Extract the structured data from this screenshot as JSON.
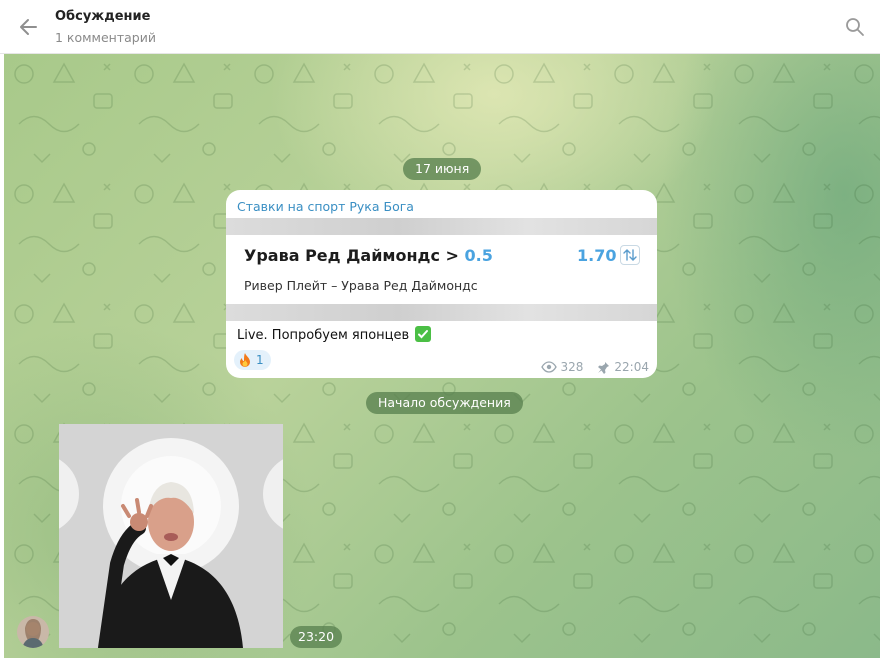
{
  "header": {
    "title": "Обсуждение",
    "subtitle": "1 комментарий",
    "back_icon": "arrow-left-icon",
    "search_icon": "search-icon"
  },
  "chat": {
    "date_separator": "17 июня",
    "discussion_start": "Начало обсуждения"
  },
  "post": {
    "channel": "Ставки на спорт Рука Бога",
    "bet_title": "Урава Ред Даймондс > ",
    "bet_value": "0.5",
    "odds": "1.70",
    "match": "Ривер Плейт – Урава Ред Даймондс",
    "text": "Live. Попробуем японцев",
    "reaction_emoji": "🔥",
    "reaction_count": "1",
    "views": "328",
    "time": "22:04"
  },
  "video_message": {
    "time": "23:20"
  },
  "colors": {
    "accent": "#4aa3e0",
    "channel": "#3a8fc3",
    "pill": "#5a8250"
  }
}
